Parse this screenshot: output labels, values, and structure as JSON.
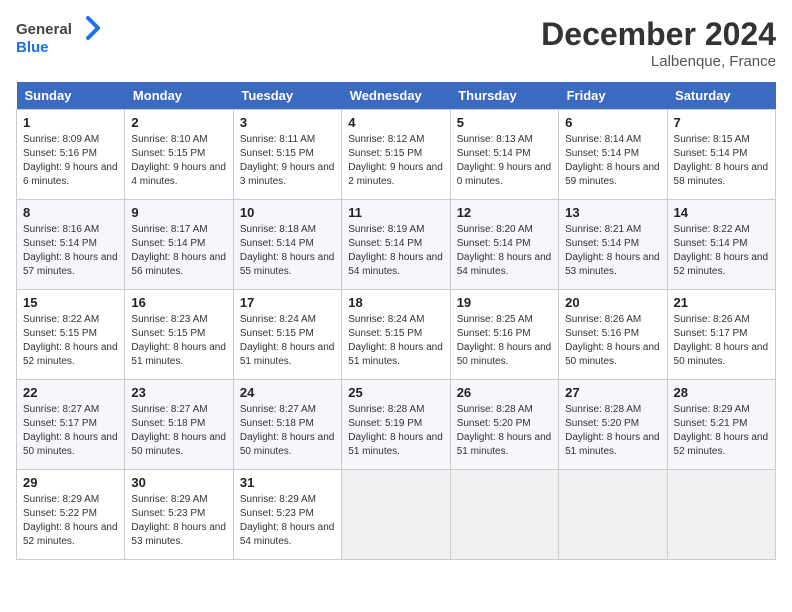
{
  "header": {
    "logo_general": "General",
    "logo_blue": "Blue",
    "month_title": "December 2024",
    "location": "Lalbenque, France"
  },
  "weekdays": [
    "Sunday",
    "Monday",
    "Tuesday",
    "Wednesday",
    "Thursday",
    "Friday",
    "Saturday"
  ],
  "weeks": [
    [
      {
        "day": "1",
        "sunrise": "8:09 AM",
        "sunset": "5:16 PM",
        "daylight": "9 hours and 6 minutes."
      },
      {
        "day": "2",
        "sunrise": "8:10 AM",
        "sunset": "5:15 PM",
        "daylight": "9 hours and 4 minutes."
      },
      {
        "day": "3",
        "sunrise": "8:11 AM",
        "sunset": "5:15 PM",
        "daylight": "9 hours and 3 minutes."
      },
      {
        "day": "4",
        "sunrise": "8:12 AM",
        "sunset": "5:15 PM",
        "daylight": "9 hours and 2 minutes."
      },
      {
        "day": "5",
        "sunrise": "8:13 AM",
        "sunset": "5:14 PM",
        "daylight": "9 hours and 0 minutes."
      },
      {
        "day": "6",
        "sunrise": "8:14 AM",
        "sunset": "5:14 PM",
        "daylight": "8 hours and 59 minutes."
      },
      {
        "day": "7",
        "sunrise": "8:15 AM",
        "sunset": "5:14 PM",
        "daylight": "8 hours and 58 minutes."
      }
    ],
    [
      {
        "day": "8",
        "sunrise": "8:16 AM",
        "sunset": "5:14 PM",
        "daylight": "8 hours and 57 minutes."
      },
      {
        "day": "9",
        "sunrise": "8:17 AM",
        "sunset": "5:14 PM",
        "daylight": "8 hours and 56 minutes."
      },
      {
        "day": "10",
        "sunrise": "8:18 AM",
        "sunset": "5:14 PM",
        "daylight": "8 hours and 55 minutes."
      },
      {
        "day": "11",
        "sunrise": "8:19 AM",
        "sunset": "5:14 PM",
        "daylight": "8 hours and 54 minutes."
      },
      {
        "day": "12",
        "sunrise": "8:20 AM",
        "sunset": "5:14 PM",
        "daylight": "8 hours and 54 minutes."
      },
      {
        "day": "13",
        "sunrise": "8:21 AM",
        "sunset": "5:14 PM",
        "daylight": "8 hours and 53 minutes."
      },
      {
        "day": "14",
        "sunrise": "8:22 AM",
        "sunset": "5:14 PM",
        "daylight": "8 hours and 52 minutes."
      }
    ],
    [
      {
        "day": "15",
        "sunrise": "8:22 AM",
        "sunset": "5:15 PM",
        "daylight": "8 hours and 52 minutes."
      },
      {
        "day": "16",
        "sunrise": "8:23 AM",
        "sunset": "5:15 PM",
        "daylight": "8 hours and 51 minutes."
      },
      {
        "day": "17",
        "sunrise": "8:24 AM",
        "sunset": "5:15 PM",
        "daylight": "8 hours and 51 minutes."
      },
      {
        "day": "18",
        "sunrise": "8:24 AM",
        "sunset": "5:15 PM",
        "daylight": "8 hours and 51 minutes."
      },
      {
        "day": "19",
        "sunrise": "8:25 AM",
        "sunset": "5:16 PM",
        "daylight": "8 hours and 50 minutes."
      },
      {
        "day": "20",
        "sunrise": "8:26 AM",
        "sunset": "5:16 PM",
        "daylight": "8 hours and 50 minutes."
      },
      {
        "day": "21",
        "sunrise": "8:26 AM",
        "sunset": "5:17 PM",
        "daylight": "8 hours and 50 minutes."
      }
    ],
    [
      {
        "day": "22",
        "sunrise": "8:27 AM",
        "sunset": "5:17 PM",
        "daylight": "8 hours and 50 minutes."
      },
      {
        "day": "23",
        "sunrise": "8:27 AM",
        "sunset": "5:18 PM",
        "daylight": "8 hours and 50 minutes."
      },
      {
        "day": "24",
        "sunrise": "8:27 AM",
        "sunset": "5:18 PM",
        "daylight": "8 hours and 50 minutes."
      },
      {
        "day": "25",
        "sunrise": "8:28 AM",
        "sunset": "5:19 PM",
        "daylight": "8 hours and 51 minutes."
      },
      {
        "day": "26",
        "sunrise": "8:28 AM",
        "sunset": "5:20 PM",
        "daylight": "8 hours and 51 minutes."
      },
      {
        "day": "27",
        "sunrise": "8:28 AM",
        "sunset": "5:20 PM",
        "daylight": "8 hours and 51 minutes."
      },
      {
        "day": "28",
        "sunrise": "8:29 AM",
        "sunset": "5:21 PM",
        "daylight": "8 hours and 52 minutes."
      }
    ],
    [
      {
        "day": "29",
        "sunrise": "8:29 AM",
        "sunset": "5:22 PM",
        "daylight": "8 hours and 52 minutes."
      },
      {
        "day": "30",
        "sunrise": "8:29 AM",
        "sunset": "5:23 PM",
        "daylight": "8 hours and 53 minutes."
      },
      {
        "day": "31",
        "sunrise": "8:29 AM",
        "sunset": "5:23 PM",
        "daylight": "8 hours and 54 minutes."
      },
      null,
      null,
      null,
      null
    ]
  ]
}
